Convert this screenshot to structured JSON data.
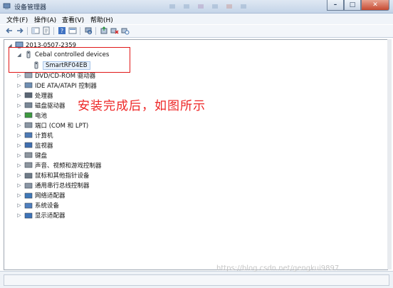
{
  "window": {
    "title": "设备管理器",
    "min": "–",
    "max": "□",
    "close": "✕"
  },
  "menu": [
    {
      "label": "文件(F)"
    },
    {
      "label": "操作(A)"
    },
    {
      "label": "查看(V)"
    },
    {
      "label": "帮助(H)"
    }
  ],
  "tree": {
    "root": "2013-0507-2359",
    "expanded_group": "Cebal controlled devices",
    "child": "SmartRF04EB",
    "categories": [
      "DVD/CD-ROM 驱动器",
      "IDE ATA/ATAPI 控制器",
      "处理器",
      "磁盘驱动器",
      "电池",
      "端口 (COM 和 LPT)",
      "计算机",
      "监视器",
      "键盘",
      "声音、视频和游戏控制器",
      "鼠标和其他指针设备",
      "通用串行总线控制器",
      "网络适配器",
      "系统设备",
      "显示适配器"
    ]
  },
  "annotation": "安装完成后，如图所示",
  "watermark": "https://blog.csdn.net/gengkui9897",
  "icons": [
    "back-icon",
    "forward-icon",
    "properties-icon",
    "refresh-icon",
    "help-icon",
    "console-tree-icon",
    "scan-hardware-icon",
    "update-driver-icon",
    "uninstall-icon",
    "disable-icon"
  ]
}
